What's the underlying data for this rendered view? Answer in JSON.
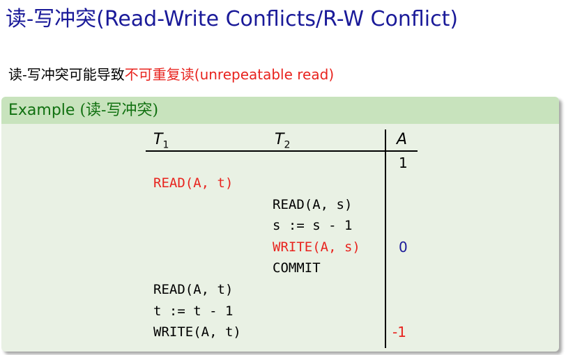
{
  "title": {
    "zh": "读-写冲突",
    "en": "(Read-Write Conflicts/R-W Conflict)"
  },
  "intro": {
    "prefix": "读-写冲突可能导致",
    "highlight": "不可重复读",
    "suffix": "(unrepeatable read)"
  },
  "example": {
    "label": "Example ",
    "label_zh": "(读-写冲突)"
  },
  "schedule": {
    "headers": {
      "t1": "T",
      "t1_sub": "1",
      "t2": "T",
      "t2_sub": "2",
      "a": "A"
    },
    "initial_a": "1",
    "rows": [
      {
        "t1": "READ(A, t)",
        "t2": "",
        "a": ""
      },
      {
        "t1": "",
        "t2": "READ(A, s)",
        "a": ""
      },
      {
        "t1": "",
        "t2": "s := s - 1",
        "a": ""
      },
      {
        "t1": "",
        "t2": "WRITE(A, s)",
        "a": "0"
      },
      {
        "t1": "",
        "t2": "COMMIT",
        "a": ""
      },
      {
        "t1": "READ(A, t)",
        "t2": "",
        "a": ""
      },
      {
        "t1": "t := t - 1",
        "t2": "",
        "a": ""
      },
      {
        "t1": "WRITE(A, t)",
        "t2": "",
        "a": "-1"
      }
    ],
    "colors": {
      "highlight": "#e8231e",
      "a_value_blue": "#1a1a99",
      "a_value_red": "#e8231e"
    }
  }
}
